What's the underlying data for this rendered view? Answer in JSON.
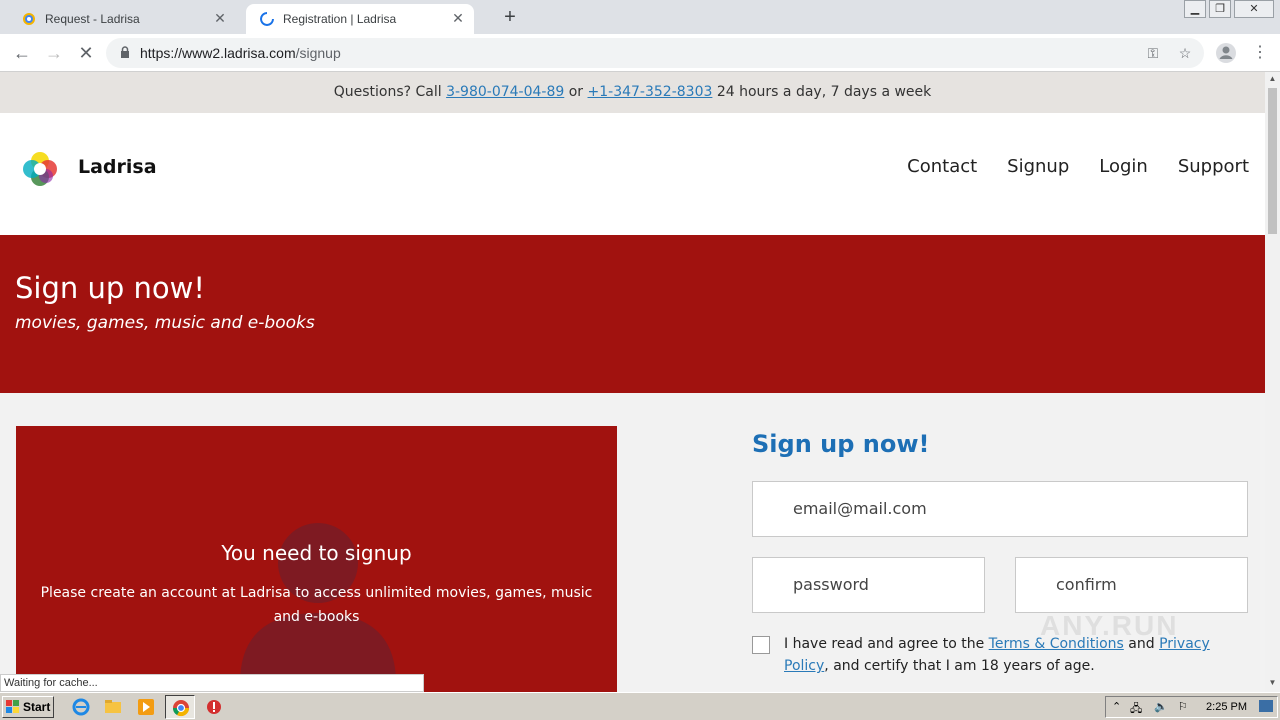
{
  "browser": {
    "tabs": [
      {
        "title": "Request - Ladrisa"
      },
      {
        "title": "Registration | Ladrisa"
      }
    ],
    "url_host": "https://www2.ladrisa.com",
    "url_path": "/signup",
    "status": "Waiting for cache..."
  },
  "page": {
    "topbar": {
      "prefix": "Questions? Call",
      "phone1": "3-980-074-04-89",
      "or": "or",
      "phone2": "+1-347-352-8303",
      "suffix": "24 hours a day, 7 days a week"
    },
    "brand": "Ladrisa",
    "nav": [
      "Contact",
      "Signup",
      "Login",
      "Support"
    ],
    "hero": {
      "title": "Sign up now!",
      "subtitle": "movies, games, music and e-books"
    },
    "notice": {
      "title": "You need to signup",
      "text": "Please create an account at Ladrisa to access unlimited movies, games, music and e-books"
    },
    "form": {
      "title": "Sign up now!",
      "email_placeholder": "email@mail.com",
      "password_placeholder": "password",
      "confirm_placeholder": "confirm",
      "agree_prefix": "I have read and agree to the",
      "terms": "Terms & Conditions",
      "and": "and",
      "privacy": "Privacy Policy",
      "agree_suffix": "and certify that I am 18 years of age."
    },
    "watermark": "ANY.RUN"
  },
  "taskbar": {
    "start": "Start",
    "clock": "2:25 PM"
  },
  "colors": {
    "brand_red": "#a1120f",
    "link_blue": "#2a7ab8",
    "title_blue": "#1d6fb5"
  }
}
